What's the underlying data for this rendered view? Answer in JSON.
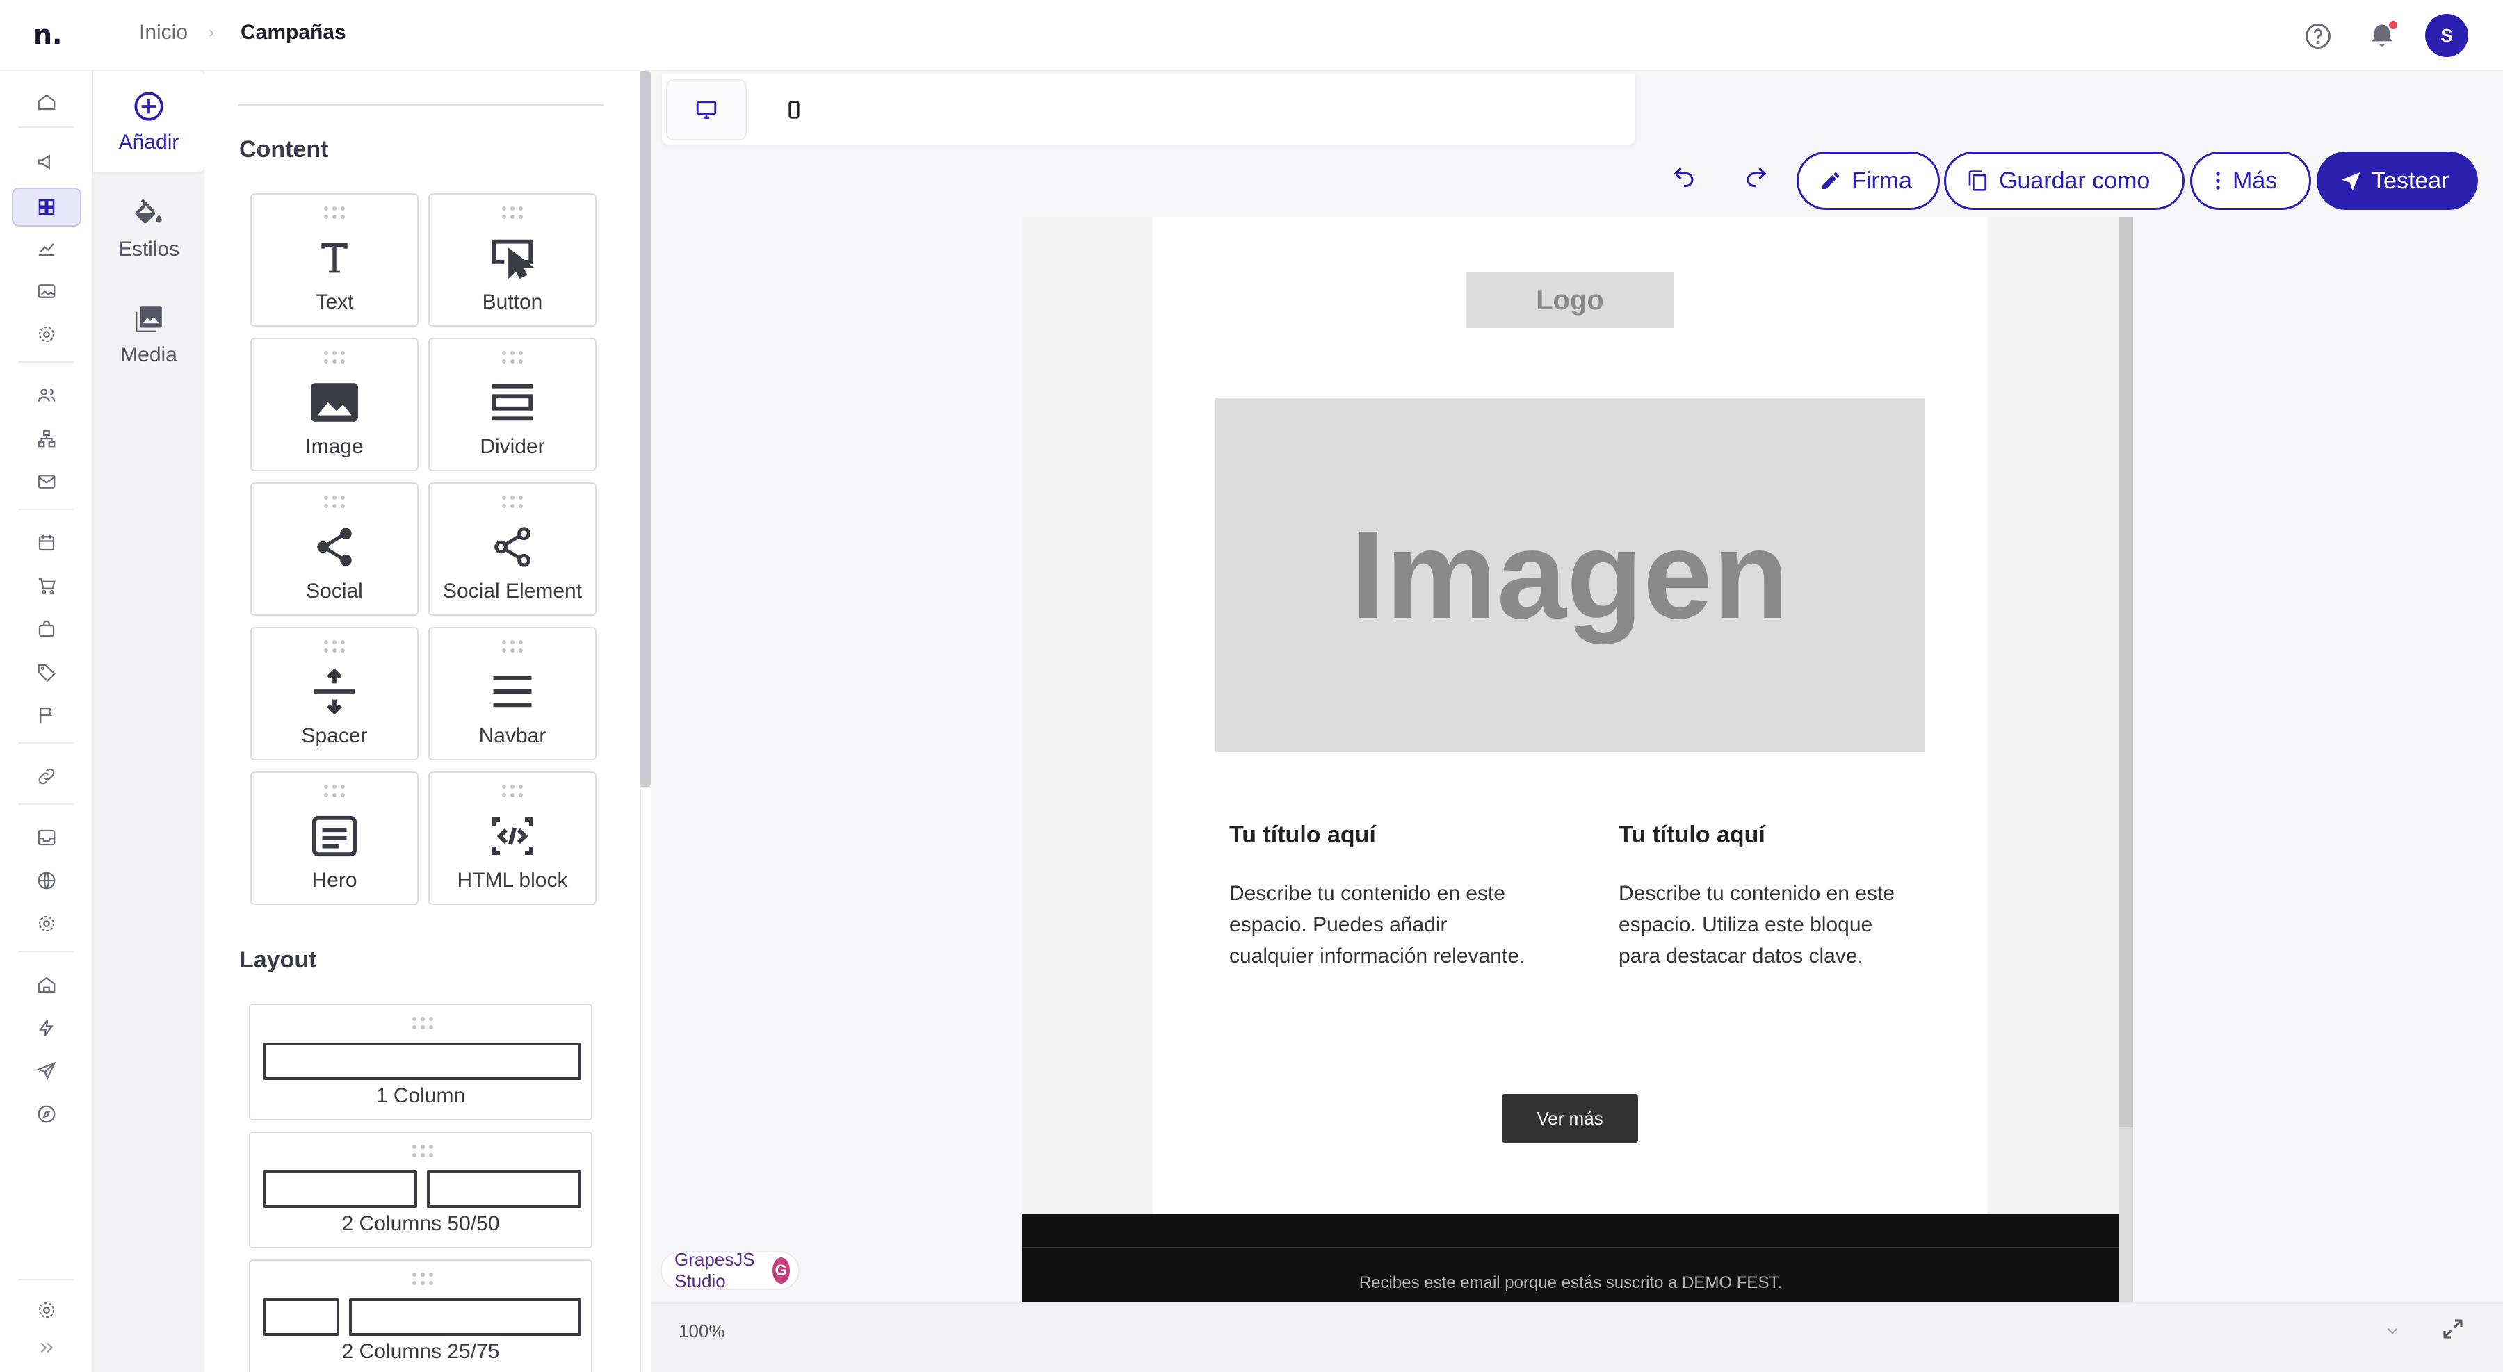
{
  "app": {
    "brand": "n."
  },
  "breadcrumb": {
    "home": "Inicio",
    "separator": "›",
    "current": "Campañas"
  },
  "user": {
    "avatar_initial": "S"
  },
  "colors": {
    "accent": "#2b1fb0",
    "notification_dot": "#e5484d",
    "footer_bg": "#111111",
    "cta_bg": "#333333",
    "placeholder_bg": "#dcdcdc"
  },
  "side_tabs": [
    {
      "label": "Añadir",
      "icon": "plus-circle-icon",
      "active": true
    },
    {
      "label": "Estilos",
      "icon": "paint-bucket-icon",
      "active": false
    },
    {
      "label": "Media",
      "icon": "image-gallery-icon",
      "active": false
    }
  ],
  "blocks_panel": {
    "content_heading": "Content",
    "content_blocks": [
      {
        "label": "Text",
        "icon": "text-icon"
      },
      {
        "label": "Button",
        "icon": "button-click-icon"
      },
      {
        "label": "Image",
        "icon": "image-icon"
      },
      {
        "label": "Divider",
        "icon": "divider-icon"
      },
      {
        "label": "Social",
        "icon": "share-icon"
      },
      {
        "label": "Social Element",
        "icon": "share-icon"
      },
      {
        "label": "Spacer",
        "icon": "spacer-icon"
      },
      {
        "label": "Navbar",
        "icon": "menu-icon"
      },
      {
        "label": "Hero",
        "icon": "hero-icon"
      },
      {
        "label": "HTML block",
        "icon": "code-icon"
      }
    ],
    "layout_heading": "Layout",
    "layout_blocks": [
      {
        "label": "1 Column"
      },
      {
        "label": "2 Columns 50/50"
      },
      {
        "label": "2 Columns 25/75"
      }
    ]
  },
  "toolbar": {
    "firma_label": "Firma",
    "guardar_label": "Guardar como",
    "mas_label": "Más",
    "testear_label": "Testear"
  },
  "email": {
    "logo_text": "Logo",
    "hero_text": "Imagen",
    "col1_title": "Tu título aquí",
    "col1_text": "Describe tu contenido en este espacio. Puedes añadir cualquier información relevante.",
    "col2_title": "Tu título aquí",
    "col2_text": "Describe tu contenido en este espacio. Utiliza este bloque para destacar datos clave.",
    "cta_label": "Ver más",
    "footer_text": "Recibes este email porque estás suscrito a DEMO FEST."
  },
  "canvas": {
    "badge_label": "GrapesJS Studio",
    "zoom_text": "100%"
  }
}
